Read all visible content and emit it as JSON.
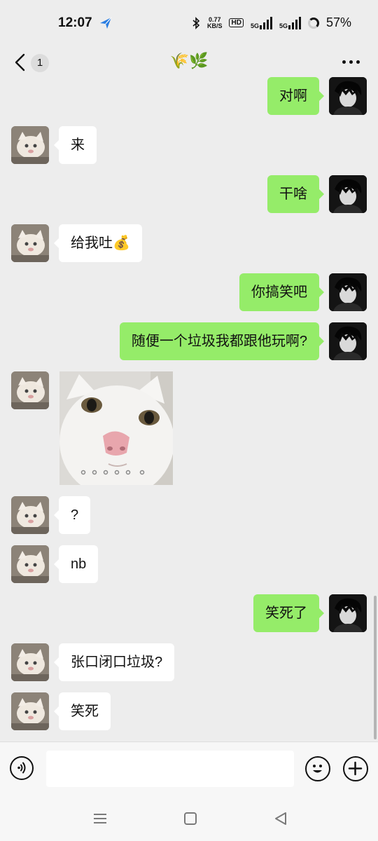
{
  "status_bar": {
    "time": "12:07",
    "net_speed_value": "0.77",
    "net_speed_unit": "KB/S",
    "hd_label": "HD",
    "sim1_label": "5G",
    "sim2_label": "5G",
    "battery": "57%"
  },
  "nav": {
    "unread_count": "1",
    "title": "🌾🌿"
  },
  "messages": [
    {
      "side": "right",
      "text": "对啊"
    },
    {
      "side": "left",
      "text": "来"
    },
    {
      "side": "right",
      "text": "干啥"
    },
    {
      "side": "left",
      "text": "给我吐💰"
    },
    {
      "side": "right",
      "text": "你搞笑吧"
    },
    {
      "side": "right",
      "text": "随便一个垃圾我都跟他玩啊?"
    },
    {
      "side": "left",
      "type": "sticker",
      "text": ""
    },
    {
      "side": "left",
      "text": "?"
    },
    {
      "side": "left",
      "text": "nb"
    },
    {
      "side": "right",
      "text": "笑死了"
    },
    {
      "side": "left",
      "text": "张口闭口垃圾?"
    },
    {
      "side": "left",
      "text": "笑死"
    }
  ],
  "input": {
    "value": "",
    "placeholder": ""
  },
  "colors": {
    "background": "#ededed",
    "sent_bubble": "#95ec69",
    "received_bubble": "#ffffff"
  }
}
